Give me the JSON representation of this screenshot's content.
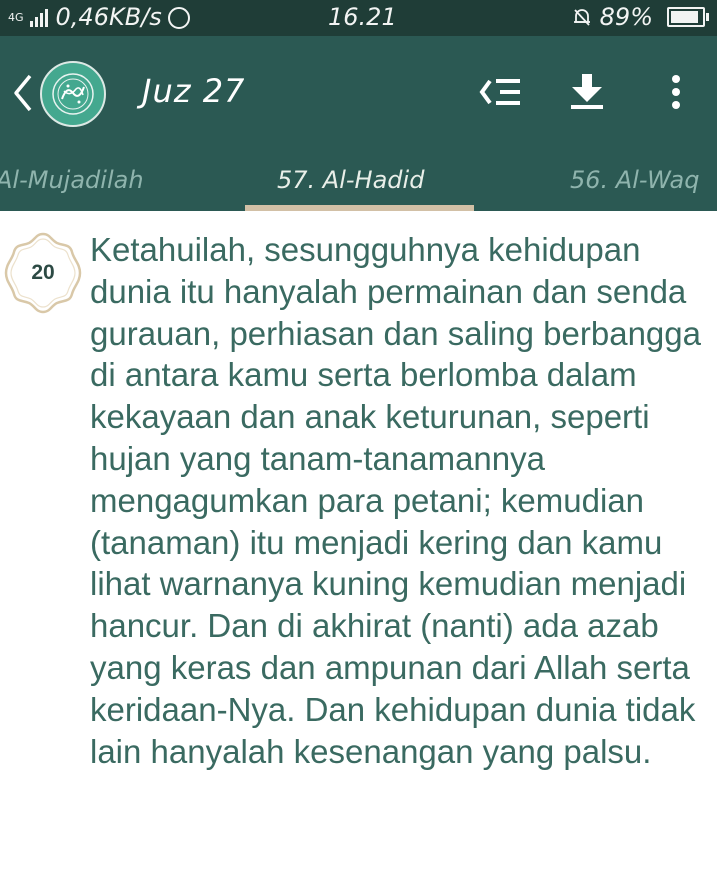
{
  "status_bar": {
    "network": "4G",
    "speed": "0,46KB/s",
    "time": "16.21",
    "battery": "89%",
    "icons": [
      "signal-bars-icon",
      "whatsapp-icon",
      "alarm-icon",
      "battery-icon"
    ]
  },
  "toolbar": {
    "title": "Juz 27",
    "icons": [
      "back-arrow-icon",
      "quran-logo-icon",
      "list-icon",
      "download-icon",
      "more-vert-icon"
    ]
  },
  "tabs": [
    {
      "label": "Al-Mujadilah"
    },
    {
      "label": "57. Al-Hadid",
      "selected": true
    },
    {
      "label": "56. Al-Waq"
    }
  ],
  "ayah": {
    "number": "20",
    "text": "Ketahuilah, sesungguhnya kehidupan dunia itu hanyalah permainan dan senda gurauan, perhiasan dan saling berbangga di antara kamu serta berlomba dalam kekayaan dan anak keturunan, seperti hujan yang tanam-tanamannya mengagumkan para petani; kemudian (tanaman) itu menjadi kering dan kamu lihat warnanya kuning kemudian menjadi hancur. Dan di akhirat (nanti) ada azab yang keras dan ampunan dari Allah serta keridaan-Nya. Dan kehidupan dunia tidak lain hanyalah kesenangan yang palsu."
  },
  "colors": {
    "status_bar": "#1f3d37",
    "app_bar": "#2b5953",
    "tab_indicator": "#d2c0a6",
    "text": "#3a6a61"
  }
}
